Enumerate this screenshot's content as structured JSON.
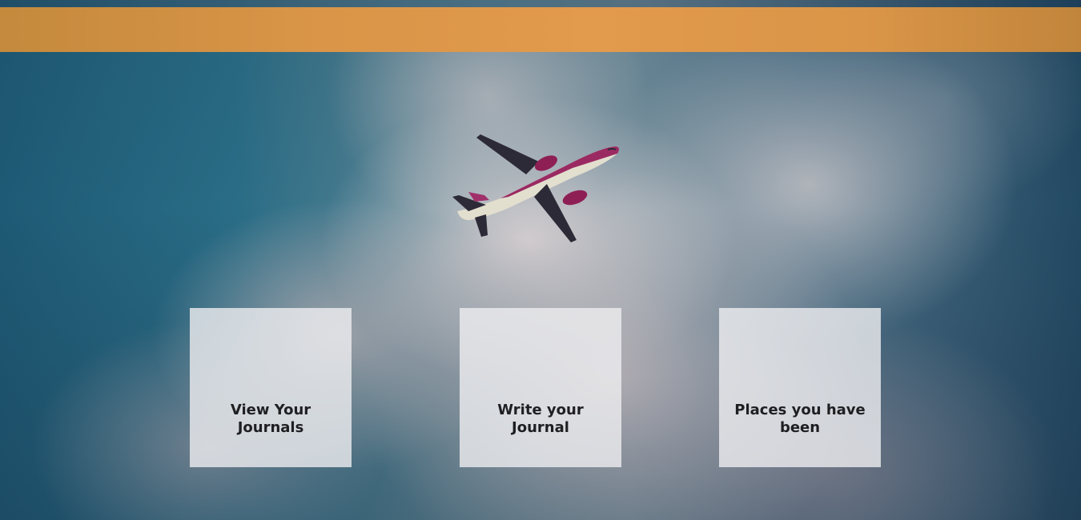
{
  "colors": {
    "header_accent": "#e29a4c",
    "card_background": "rgba(238,238,240,0.80)",
    "card_text": "#1f1f22"
  },
  "hero": {
    "image": "airplane-icon"
  },
  "cards": [
    {
      "label": "View Your Journals"
    },
    {
      "label": "Write your Journal"
    },
    {
      "label": "Places you have been"
    }
  ]
}
